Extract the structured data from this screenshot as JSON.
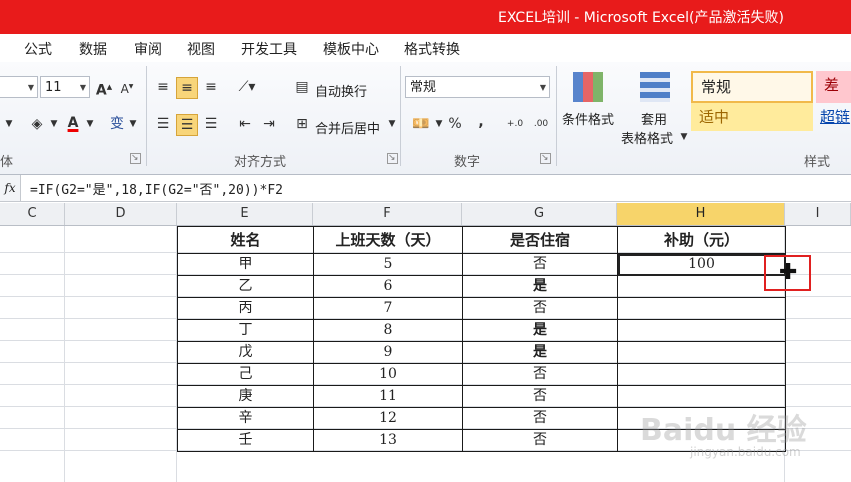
{
  "window": {
    "title": "EXCEL培训 - Microsoft Excel(产品激活失败)"
  },
  "menu_tabs": [
    "公式",
    "数据",
    "审阅",
    "视图",
    "开发工具",
    "模板中心",
    "格式转换"
  ],
  "ribbon": {
    "font_group_label_partial": "体",
    "font_size": "11",
    "alignment": {
      "label": "对齐方式",
      "wrap_text": "自动换行",
      "merge_center": "合并后居中"
    },
    "number": {
      "label": "数字",
      "format_value": "常规",
      "percent": "%",
      "comma": ","
    },
    "styles": {
      "label": "样式",
      "conditional_format": "条件格式",
      "table_format_line1": "套用",
      "table_format_line2": "表格格式",
      "cell_styles": [
        {
          "name": "常规",
          "bg": "#fff8e8"
        },
        {
          "name": "差",
          "bg": "#ffc7ce"
        },
        {
          "name": "适中",
          "bg": "#ffeb9c"
        },
        {
          "name": "超链",
          "bg": "#ffffff"
        }
      ]
    }
  },
  "formula_bar": {
    "fx_label": "fx",
    "formula": "=IF(G2=\"是\",18,IF(G2=\"否\",20))*F2"
  },
  "columns": [
    "C",
    "D",
    "E",
    "F",
    "G",
    "H",
    "I"
  ],
  "selected_column": "H",
  "table": {
    "headers": [
      "姓名",
      "上班天数（天）",
      "是否住宿",
      "补助（元）"
    ],
    "rows": [
      [
        "甲",
        "5",
        "否",
        "100"
      ],
      [
        "乙",
        "6",
        "是",
        ""
      ],
      [
        "丙",
        "7",
        "否",
        ""
      ],
      [
        "丁",
        "8",
        "是",
        ""
      ],
      [
        "戊",
        "9",
        "是",
        ""
      ],
      [
        "己",
        "10",
        "否",
        ""
      ],
      [
        "庚",
        "11",
        "否",
        ""
      ],
      [
        "辛",
        "12",
        "否",
        ""
      ],
      [
        "壬",
        "13",
        "否",
        ""
      ]
    ]
  },
  "watermark": {
    "text": "Baidu 经验",
    "url_text": "jingyan.baidu.com"
  },
  "colors": {
    "title_bar": "#e81b1b",
    "selected_header": "#f7d46a",
    "highlight_box": "#e02020"
  }
}
